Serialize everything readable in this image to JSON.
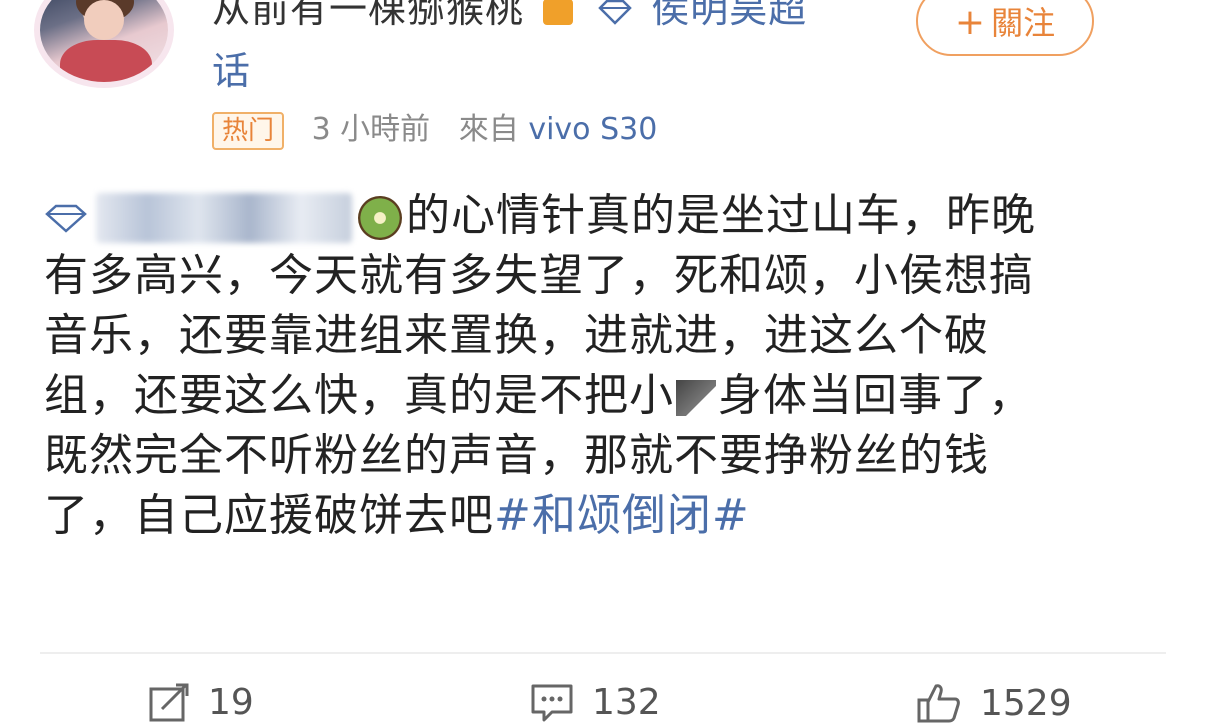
{
  "header": {
    "nickname": "从前有一棵猕猴桃",
    "supertopic": "侯明昊超",
    "supertopic_cont": "话",
    "follow_label": "關注",
    "follow_plus": "+"
  },
  "meta": {
    "hot_badge": "热门",
    "time": "3 小時前",
    "source_prefix": "來自",
    "source_device": "vivo S30"
  },
  "post": {
    "line1_text": "的心情针真的是坐过山车，昨晚",
    "line2_text": "有多高兴，今天就有多失望了，死和颂，小侯想搞",
    "line3_text": "音乐，还要靠进组来置换，进就进，进这么个破",
    "line4_a": "组，还要这么快，真的是不把小",
    "line4_b": "身体当回事了，",
    "line5_text": "既然完全不听粉丝的声音，那就不要挣粉丝的钱",
    "line6_text": "了，自己应援破饼去吧",
    "hashtag": "#和颂倒闭#"
  },
  "actions": {
    "repost_count": "19",
    "comment_count": "132",
    "like_count": "1529"
  },
  "colors": {
    "link_blue": "#4b6ea9",
    "accent_orange": "#e8843a",
    "text": "#222222",
    "meta_gray": "#8a8a8a"
  },
  "icons": [
    "crown-icon",
    "diamond-icon",
    "kiwi-icon",
    "repost-icon",
    "comment-icon",
    "like-icon"
  ]
}
